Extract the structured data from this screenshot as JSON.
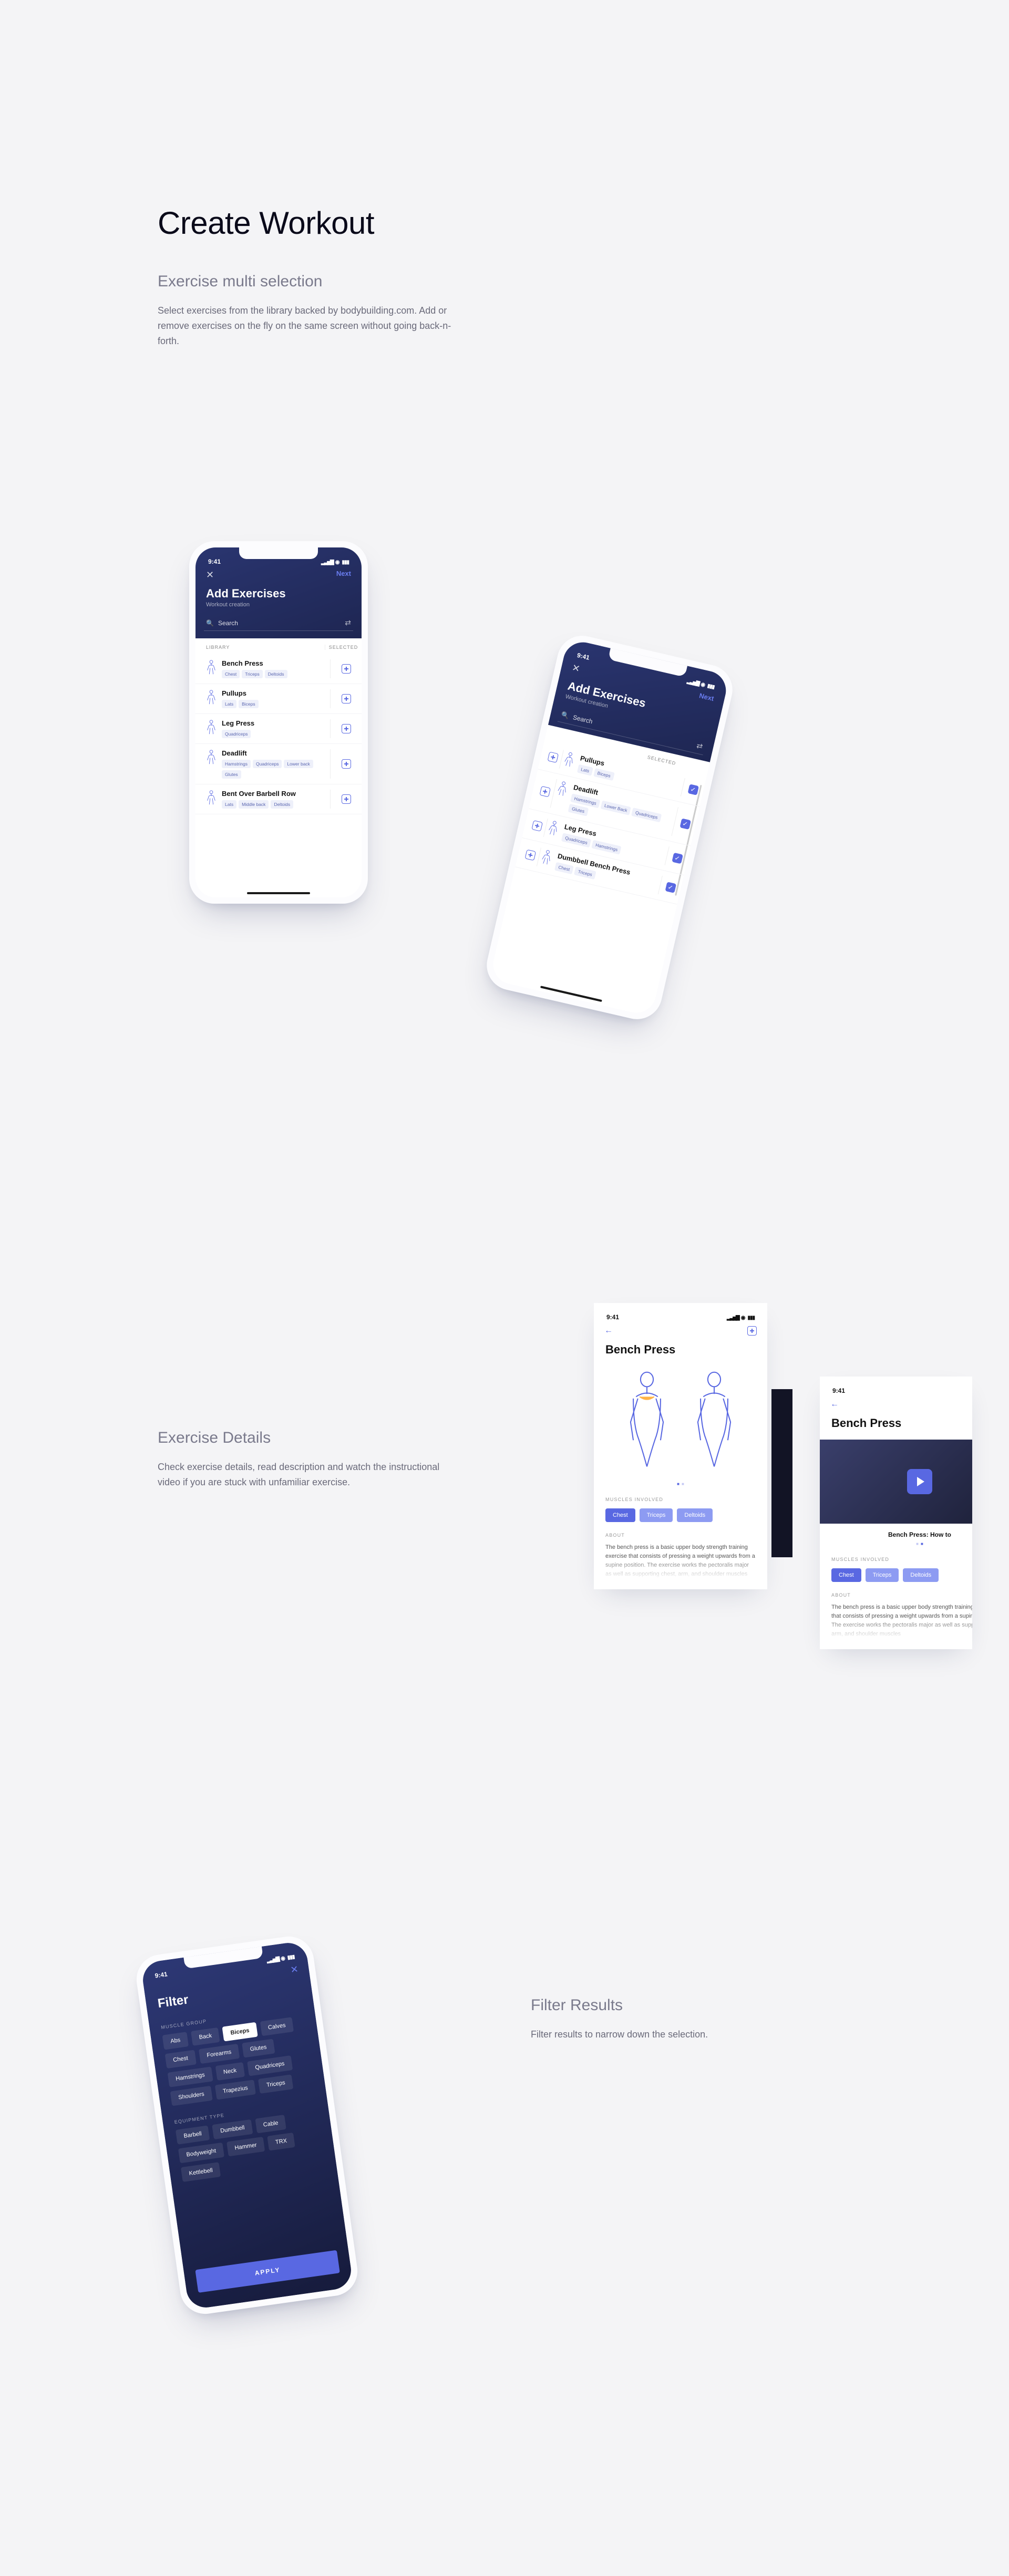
{
  "page": {
    "heading": "Create Workout",
    "sec1_title": "Exercise multi selection",
    "sec1_body": "Select exercises from the library backed by bodybuilding.com. Add or remove exercises on the fly on the same screen without going back-n-forth.",
    "sec2_title": "Exercise Details",
    "sec2_body": "Check exercise details, read description and watch the instructional video if you are stuck with unfamiliar exercise.",
    "sec3_title": "Filter Results",
    "sec3_body": "Filter results to narrow down the selection."
  },
  "device": {
    "time": "9:41"
  },
  "add": {
    "title": "Add Exercises",
    "subtitle": "Workout creation",
    "next": "Next",
    "search": "Search",
    "col_library": "LIBRARY",
    "col_selected": "SELECTED"
  },
  "library": [
    {
      "name": "Bench Press",
      "tags": [
        "Chest",
        "Triceps",
        "Deltoids"
      ]
    },
    {
      "name": "Pullups",
      "tags": [
        "Lats",
        "Biceps"
      ]
    },
    {
      "name": "Leg Press",
      "tags": [
        "Quadriceps"
      ]
    },
    {
      "name": "Deadlift",
      "tags": [
        "Hamstrings",
        "Quadriceps",
        "Lower back",
        "Glutes"
      ]
    },
    {
      "name": "Bent Over Barbell Row",
      "tags": [
        "Lats",
        "Middle back",
        "Deltoids"
      ]
    }
  ],
  "selected": [
    {
      "name": "Pullups",
      "tags": [
        "Lats",
        "Biceps"
      ]
    },
    {
      "name": "Deadlift",
      "tags": [
        "Hamstrings",
        "Lower Back",
        "Quadriceps",
        "Glutes"
      ]
    },
    {
      "name": "Leg Press",
      "tags": [
        "Quadriceps",
        "Hamstrings"
      ]
    },
    {
      "name": "Dumbbell Bench Press",
      "tags": [
        "Chest",
        "Triceps"
      ]
    }
  ],
  "details": {
    "title": "Bench Press",
    "muscles_label": "MUSCLES INVOLVED",
    "about_label": "ABOUT",
    "muscles": [
      "Chest",
      "Triceps",
      "Deltoids"
    ],
    "about": "The bench press is a basic upper body strength training exercise that consists of pressing a weight upwards from a supine position. The exercise works the pectoralis major as well as supporting chest, arm, and shoulder muscles",
    "video_caption": "Bench Press: How to"
  },
  "filter": {
    "title": "Filter",
    "group_label": "MUSCLE GROUP",
    "groups": [
      "Abs",
      "Back",
      "Biceps",
      "Calves",
      "Chest",
      "Forearms",
      "Glutes",
      "Hamstrings",
      "Neck",
      "Quadriceps",
      "Shoulders",
      "Trapezius",
      "Triceps"
    ],
    "group_selected": "Biceps",
    "equip_label": "EQUIPMENT TYPE",
    "equipment": [
      "Barbell",
      "Dumbbell",
      "Cable",
      "Bodyweight",
      "Hammer",
      "TRX",
      "Kettlebell"
    ],
    "apply": "APPLY"
  }
}
